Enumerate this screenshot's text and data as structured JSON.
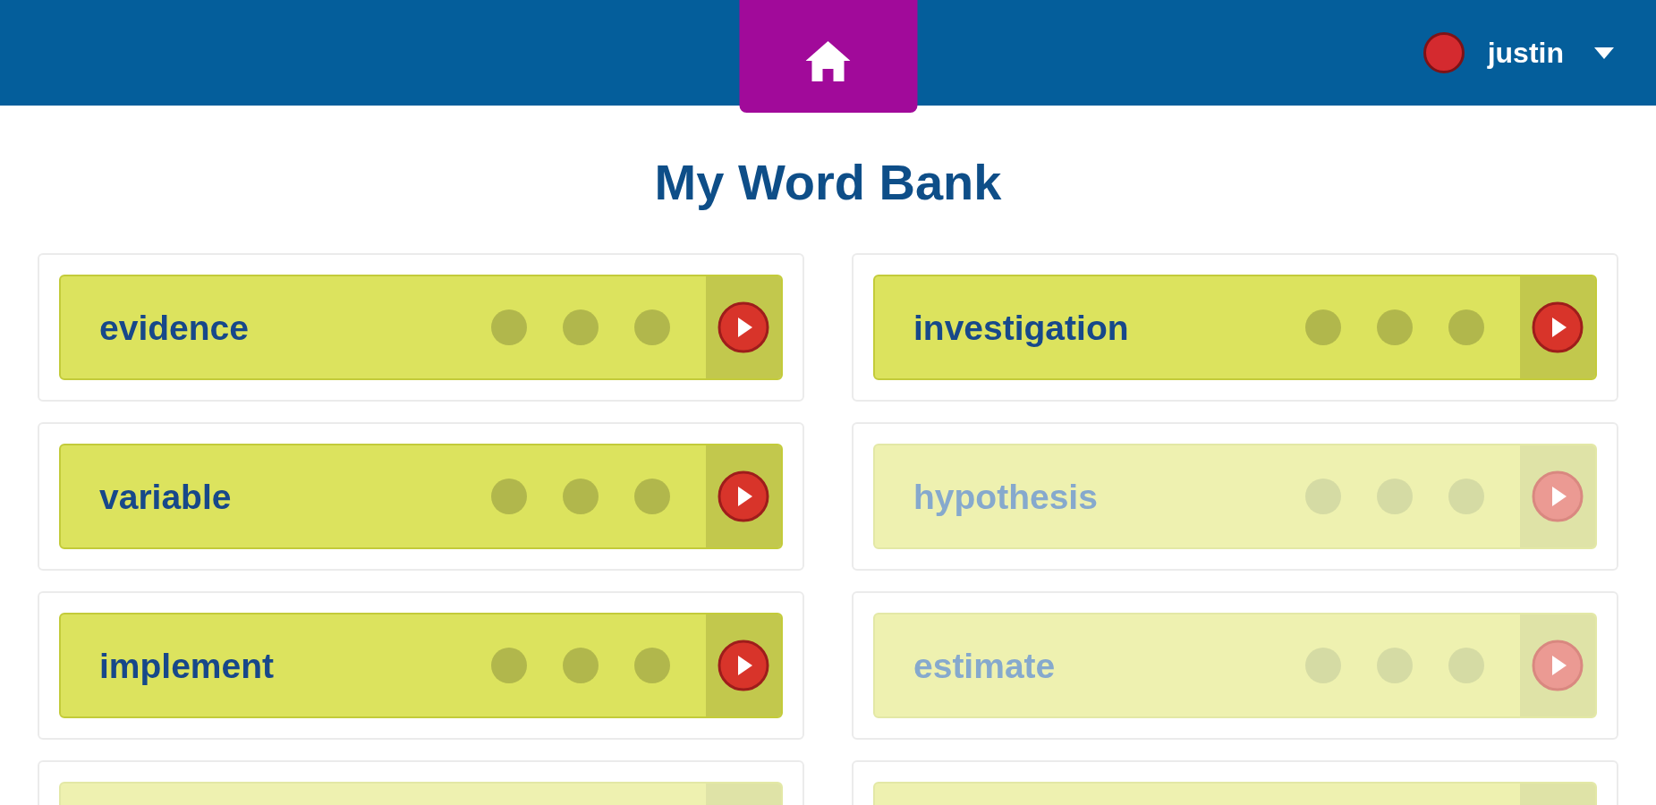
{
  "header": {
    "home_tab": {
      "selected": true
    },
    "user": {
      "name": "justin"
    }
  },
  "title": "My Word Bank",
  "words": [
    {
      "word": "evidence",
      "disabled": false
    },
    {
      "word": "investigation",
      "disabled": false
    },
    {
      "word": "variable",
      "disabled": false
    },
    {
      "word": "hypothesis",
      "disabled": true
    },
    {
      "word": "implement",
      "disabled": false
    },
    {
      "word": "estimate",
      "disabled": true
    },
    {
      "disabled": true
    },
    {
      "disabled": true
    }
  ]
}
